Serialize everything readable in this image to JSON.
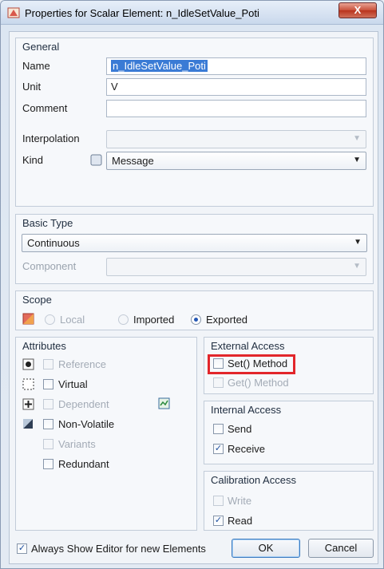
{
  "window": {
    "title": "Properties for Scalar Element: n_IdleSetValue_Poti",
    "close_label": "X"
  },
  "general": {
    "title": "General",
    "name_label": "Name",
    "name_value": "n_IdleSetValue_Poti",
    "unit_label": "Unit",
    "unit_value": "V",
    "comment_label": "Comment",
    "comment_value": "",
    "interpolation_label": "Interpolation",
    "interpolation_value": "",
    "kind_label": "Kind",
    "kind_value": "Message"
  },
  "basic_type": {
    "title": "Basic Type",
    "type_value": "Continuous",
    "component_label": "Component",
    "component_value": ""
  },
  "scope": {
    "title": "Scope",
    "options": [
      {
        "label": "Local",
        "selected": false,
        "enabled": false
      },
      {
        "label": "Imported",
        "selected": false,
        "enabled": false
      },
      {
        "label": "Exported",
        "selected": true,
        "enabled": true
      }
    ]
  },
  "attributes": {
    "title": "Attributes",
    "items": [
      {
        "label": "Reference",
        "checked": false,
        "enabled": false
      },
      {
        "label": "Virtual",
        "checked": false,
        "enabled": true
      },
      {
        "label": "Dependent",
        "checked": false,
        "enabled": false
      },
      {
        "label": "Non-Volatile",
        "checked": false,
        "enabled": true
      },
      {
        "label": "Variants",
        "checked": false,
        "enabled": false
      },
      {
        "label": "Redundant",
        "checked": false,
        "enabled": true
      }
    ]
  },
  "external_access": {
    "title": "External Access",
    "set_method": {
      "label": "Set() Method",
      "checked": false,
      "enabled": true
    },
    "get_method": {
      "label": "Get() Method",
      "checked": false,
      "enabled": false
    }
  },
  "internal_access": {
    "title": "Internal Access",
    "send": {
      "label": "Send",
      "checked": false,
      "enabled": true
    },
    "receive": {
      "label": "Receive",
      "checked": true,
      "enabled": true
    }
  },
  "calibration_access": {
    "title": "Calibration Access",
    "write": {
      "label": "Write",
      "checked": false,
      "enabled": false
    },
    "read": {
      "label": "Read",
      "checked": true,
      "enabled": true
    }
  },
  "footer": {
    "always_show_label": "Always Show Editor for new Elements",
    "always_show_checked": true,
    "ok_label": "OK",
    "cancel_label": "Cancel"
  },
  "colors": {
    "highlight": "#e2262b",
    "selection": "#3a7bd5"
  }
}
